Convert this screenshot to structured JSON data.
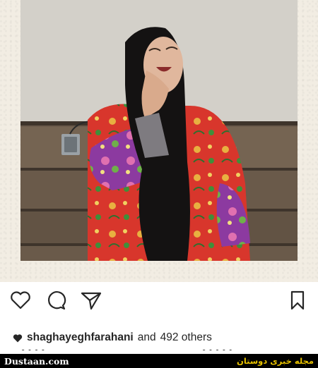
{
  "post": {
    "likes": {
      "username": "shaghayeghfarahani",
      "connector": "and",
      "others": "492 others"
    },
    "partial_text_left": "• • • •",
    "partial_text_right": "• • • • •"
  },
  "actions": {
    "like_icon": "heart-outline-icon",
    "comment_icon": "comment-bubble-icon",
    "share_icon": "paper-plane-icon",
    "save_icon": "bookmark-icon"
  },
  "watermark": {
    "site": "Dustaan.com",
    "tagline": "مجله خبری دوستان"
  },
  "colors": {
    "frame": "#f2ede3",
    "text": "#262626",
    "watermark_bg": "#000000",
    "watermark_tagline": "#e8c200"
  }
}
